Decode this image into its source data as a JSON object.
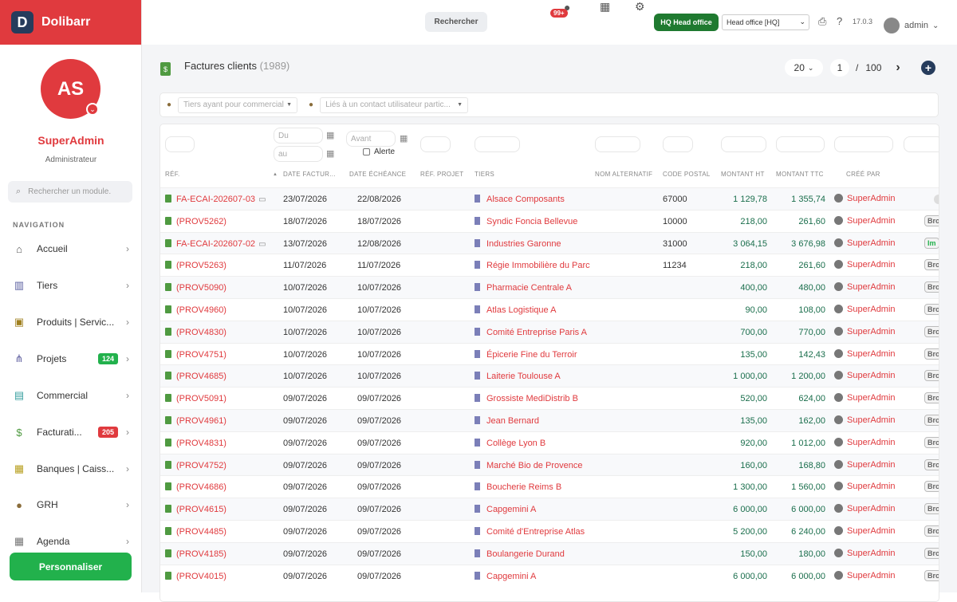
{
  "brand": {
    "name": "Dolibarr",
    "logo": "D"
  },
  "user": {
    "initials": "AS",
    "name": "SuperAdmin",
    "role": "Administrateur"
  },
  "sidebar": {
    "search_placeholder": "Rechercher un module.",
    "nav_title": "NAVIGATION",
    "items": [
      {
        "label": "Accueil",
        "icon": "home-icon",
        "glyph": "⌂",
        "color": "#555"
      },
      {
        "label": "Tiers",
        "icon": "building-icon",
        "glyph": "▥",
        "color": "#5a5fa0"
      },
      {
        "label": "Produits | Servic...",
        "icon": "box-icon",
        "glyph": "▣",
        "color": "#a08020"
      },
      {
        "label": "Projets",
        "icon": "sitemap-icon",
        "glyph": "⋔",
        "color": "#6060a0",
        "badge": "124",
        "badge_color": "#22b14c"
      },
      {
        "label": "Commercial",
        "icon": "briefcase-icon",
        "glyph": "▤",
        "color": "#3aa0a0"
      },
      {
        "label": "Facturati...",
        "icon": "invoice-icon",
        "glyph": "$",
        "color": "#4f9a41",
        "badge": "205",
        "badge_color": "#e03a3e"
      },
      {
        "label": "Banques | Caiss...",
        "icon": "bank-icon",
        "glyph": "▦",
        "color": "#b8a020"
      },
      {
        "label": "GRH",
        "icon": "user-tie-icon",
        "glyph": "●",
        "color": "#8a6d3b"
      },
      {
        "label": "Agenda",
        "icon": "calendar-icon",
        "glyph": "▦",
        "color": "#777"
      }
    ],
    "personalize": "Personnaliser"
  },
  "topbar": {
    "search_button": "Rechercher",
    "notif_count": "99+",
    "hq_button": "HQ Head office",
    "entity_select": "Head office [HQ]",
    "version": "17.0.3",
    "username": "admin"
  },
  "page": {
    "title": "Factures clients",
    "count": "(1989)"
  },
  "pager": {
    "per_page": "20",
    "page": "1",
    "separator": "/",
    "total_pages": "100"
  },
  "filters": {
    "commercial": "Tiers ayant pour commercial",
    "contact": "Liés à un contact utilisateur partic...",
    "date_from": "Du",
    "date_to": "au",
    "due_before": "Avant",
    "alert": "Alerte"
  },
  "columns": [
    "RÉF.",
    "DATE FACTUR...",
    "DATE ÉCHÉANCE",
    "RÉF. PROJET",
    "TIERS",
    "NOM ALTERNATIF",
    "CODE POSTAL",
    "MONTANT HT",
    "MONTANT TTC",
    "CRÉÉ PAR"
  ],
  "rows": [
    {
      "ref": "FA-ECAI-202607-03",
      "note": true,
      "date": "23/07/2026",
      "due": "22/08/2026",
      "tiers": "Alsace Composants",
      "cp": "67000",
      "ht": "1 129,78",
      "ttc": "1 355,74",
      "by": "SuperAdmin",
      "status": ""
    },
    {
      "ref": "(PROV5262)",
      "date": "18/07/2026",
      "due": "18/07/2026",
      "tiers": "Syndic Foncia Bellevue",
      "cp": "10000",
      "ht": "218,00",
      "ttc": "261,60",
      "by": "SuperAdmin",
      "status": "Bro"
    },
    {
      "ref": "FA-ECAI-202607-02",
      "note": true,
      "date": "13/07/2026",
      "due": "12/08/2026",
      "tiers": "Industries Garonne",
      "cp": "31000",
      "ht": "3 064,15",
      "ttc": "3 676,98",
      "by": "SuperAdmin",
      "status": "Im"
    },
    {
      "ref": "(PROV5263)",
      "date": "11/07/2026",
      "due": "11/07/2026",
      "tiers": "Régie Immobilière du Parc",
      "cp": "11234",
      "ht": "218,00",
      "ttc": "261,60",
      "by": "SuperAdmin",
      "status": "Bro"
    },
    {
      "ref": "(PROV5090)",
      "date": "10/07/2026",
      "due": "10/07/2026",
      "tiers": "Pharmacie Centrale A",
      "cp": "",
      "ht": "400,00",
      "ttc": "480,00",
      "by": "SuperAdmin",
      "status": "Bro"
    },
    {
      "ref": "(PROV4960)",
      "date": "10/07/2026",
      "due": "10/07/2026",
      "tiers": "Atlas Logistique A",
      "cp": "",
      "ht": "90,00",
      "ttc": "108,00",
      "by": "SuperAdmin",
      "status": "Bro"
    },
    {
      "ref": "(PROV4830)",
      "date": "10/07/2026",
      "due": "10/07/2026",
      "tiers": "Comité Entreprise Paris A",
      "cp": "",
      "ht": "700,00",
      "ttc": "770,00",
      "by": "SuperAdmin",
      "status": "Bro"
    },
    {
      "ref": "(PROV4751)",
      "date": "10/07/2026",
      "due": "10/07/2026",
      "tiers": "Épicerie Fine du Terroir",
      "cp": "",
      "ht": "135,00",
      "ttc": "142,43",
      "by": "SuperAdmin",
      "status": "Bro"
    },
    {
      "ref": "(PROV4685)",
      "date": "10/07/2026",
      "due": "10/07/2026",
      "tiers": "Laiterie Toulouse A",
      "cp": "",
      "ht": "1 000,00",
      "ttc": "1 200,00",
      "by": "SuperAdmin",
      "status": "Bro"
    },
    {
      "ref": "(PROV5091)",
      "date": "09/07/2026",
      "due": "09/07/2026",
      "tiers": "Grossiste MediDistrib B",
      "cp": "",
      "ht": "520,00",
      "ttc": "624,00",
      "by": "SuperAdmin",
      "status": "Bro"
    },
    {
      "ref": "(PROV4961)",
      "date": "09/07/2026",
      "due": "09/07/2026",
      "tiers": "Jean Bernard",
      "cp": "",
      "ht": "135,00",
      "ttc": "162,00",
      "by": "SuperAdmin",
      "status": "Bro"
    },
    {
      "ref": "(PROV4831)",
      "date": "09/07/2026",
      "due": "09/07/2026",
      "tiers": "Collège Lyon B",
      "cp": "",
      "ht": "920,00",
      "ttc": "1 012,00",
      "by": "SuperAdmin",
      "status": "Bro"
    },
    {
      "ref": "(PROV4752)",
      "date": "09/07/2026",
      "due": "09/07/2026",
      "tiers": "Marché Bio de Provence",
      "cp": "",
      "ht": "160,00",
      "ttc": "168,80",
      "by": "SuperAdmin",
      "status": "Bro"
    },
    {
      "ref": "(PROV4686)",
      "date": "09/07/2026",
      "due": "09/07/2026",
      "tiers": "Boucherie Reims B",
      "cp": "",
      "ht": "1 300,00",
      "ttc": "1 560,00",
      "by": "SuperAdmin",
      "status": "Bro"
    },
    {
      "ref": "(PROV4615)",
      "date": "09/07/2026",
      "due": "09/07/2026",
      "tiers": "Capgemini A",
      "cp": "",
      "ht": "6 000,00",
      "ttc": "6 000,00",
      "by": "SuperAdmin",
      "status": "Bro"
    },
    {
      "ref": "(PROV4485)",
      "date": "09/07/2026",
      "due": "09/07/2026",
      "tiers": "Comité d'Entreprise Atlas",
      "cp": "",
      "ht": "5 200,00",
      "ttc": "6 240,00",
      "by": "SuperAdmin",
      "status": "Bro"
    },
    {
      "ref": "(PROV4185)",
      "date": "09/07/2026",
      "due": "09/07/2026",
      "tiers": "Boulangerie Durand",
      "cp": "",
      "ht": "150,00",
      "ttc": "180,00",
      "by": "SuperAdmin",
      "status": "Bro"
    },
    {
      "ref": "(PROV4015)",
      "date": "09/07/2026",
      "due": "09/07/2026",
      "tiers": "Capgemini A",
      "cp": "",
      "ht": "6 000,00",
      "ttc": "6 000,00",
      "by": "SuperAdmin",
      "status": "Bro"
    }
  ]
}
